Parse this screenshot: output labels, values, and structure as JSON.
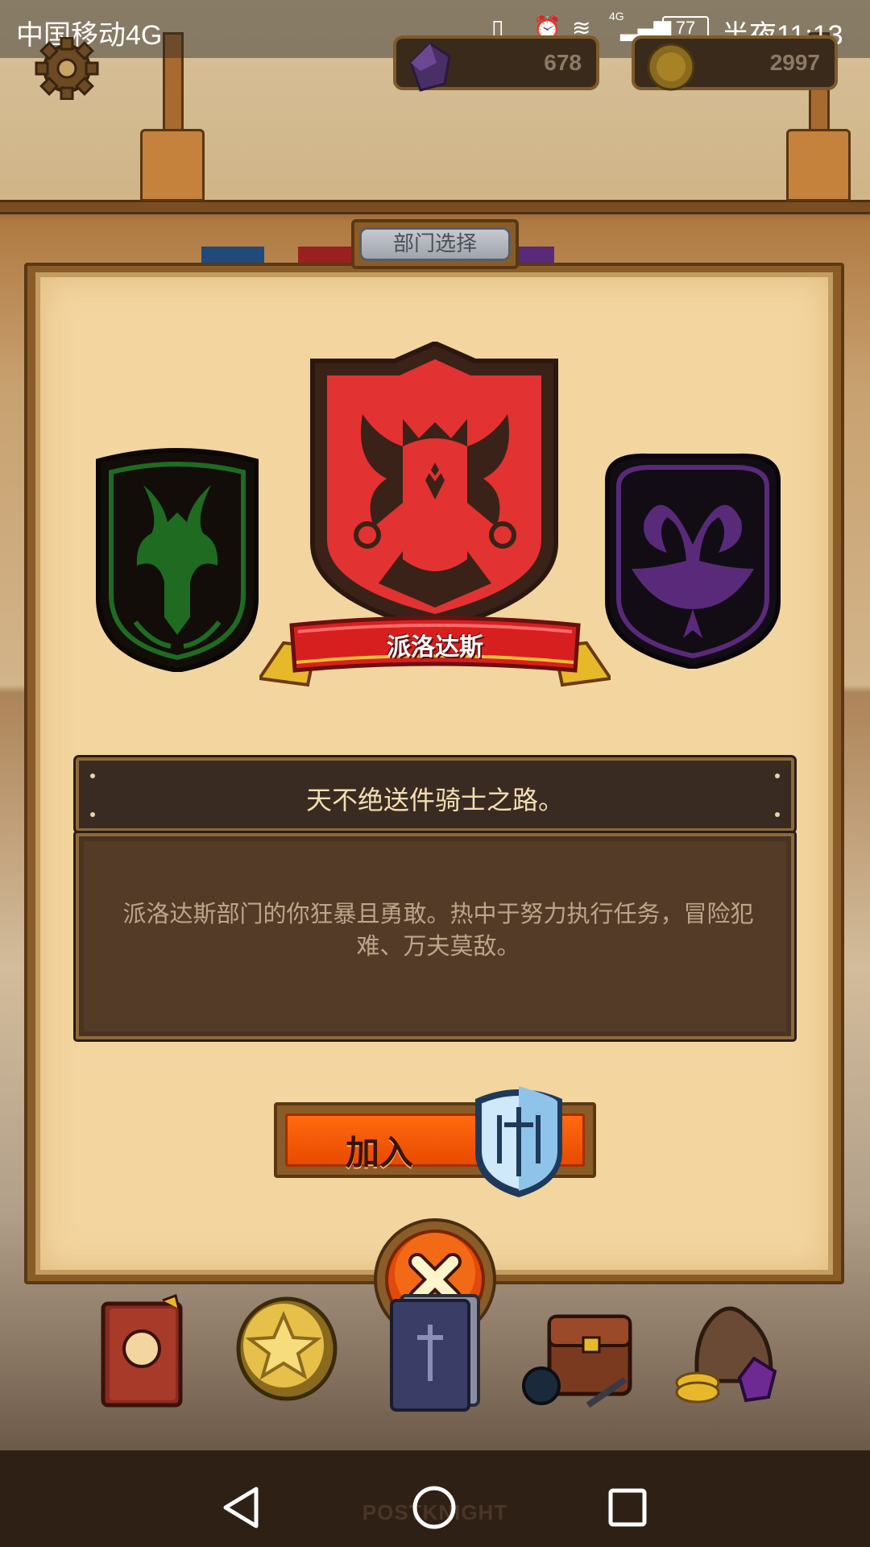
{
  "status_bar": {
    "carrier": "中国移动4G",
    "network_label": "4G",
    "battery": "77",
    "time": "半夜11:13"
  },
  "hud": {
    "gems": "678",
    "gold": "2997"
  },
  "dialog": {
    "title": "部门选择",
    "selected_department": "派洛达斯",
    "motto": "天不绝送件骑士之路。",
    "description": "派洛达斯部门的你狂暴且勇敢。热中于努力执行任务，冒险犯难、万夫莫敌。",
    "join_label": "加入"
  },
  "footer": {
    "logo": "POSTKNIGHT"
  },
  "colors": {
    "paper": "#f3d59f",
    "frame": "#8a5c28",
    "red_crest": "#e23232",
    "green_crest": "#1f6b22",
    "purple_crest": "#5a2a7a",
    "join_orange": "#ff5a00"
  },
  "icons": {
    "settings": "gear-icon",
    "gem": "gem-icon",
    "coin": "coin-icon",
    "close": "close-icon",
    "join_shield": "shield-icon",
    "nav_back": "back-icon",
    "nav_home": "home-icon",
    "nav_recent": "recent-apps-icon"
  }
}
